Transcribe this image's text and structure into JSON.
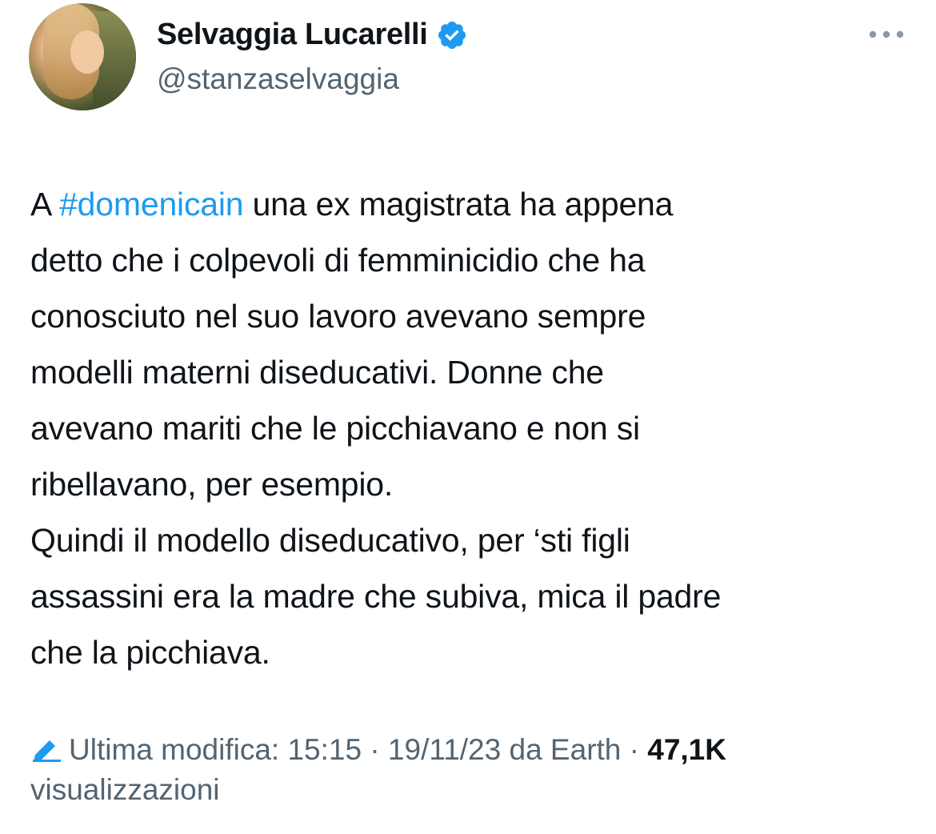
{
  "author": {
    "name": "Selvaggia Lucarelli",
    "handle": "@stanzaselvaggia",
    "verified": true
  },
  "tweet": {
    "prefix": "A ",
    "hashtag": "#domenicain",
    "body": " una ex magistrata ha appena\ndetto che i colpevoli di femminicidio che ha\nconosciuto nel suo lavoro avevano sempre\nmodelli materni diseducativi. Donne che\navevano mariti che le picchiavano e non si\nribellavano, per esempio.\nQuindi il modello diseducativo, per ‘sti figli\nassassini era la madre che subiva, mica il padre\nche la picchiava."
  },
  "meta": {
    "edited_label": "Ultima modifica: 15:15 · 19/11/23",
    "source": " da Earth · ",
    "views_count": "47,1K",
    "views_label": "visualizzazioni"
  },
  "icons": {
    "verified": "verified-badge-icon",
    "more": "more-horizontal-icon",
    "edit": "pencil-edit-icon"
  },
  "colors": {
    "accent": "#1d9bf0",
    "secondary_text": "#536471",
    "primary_text": "#0f1419"
  }
}
